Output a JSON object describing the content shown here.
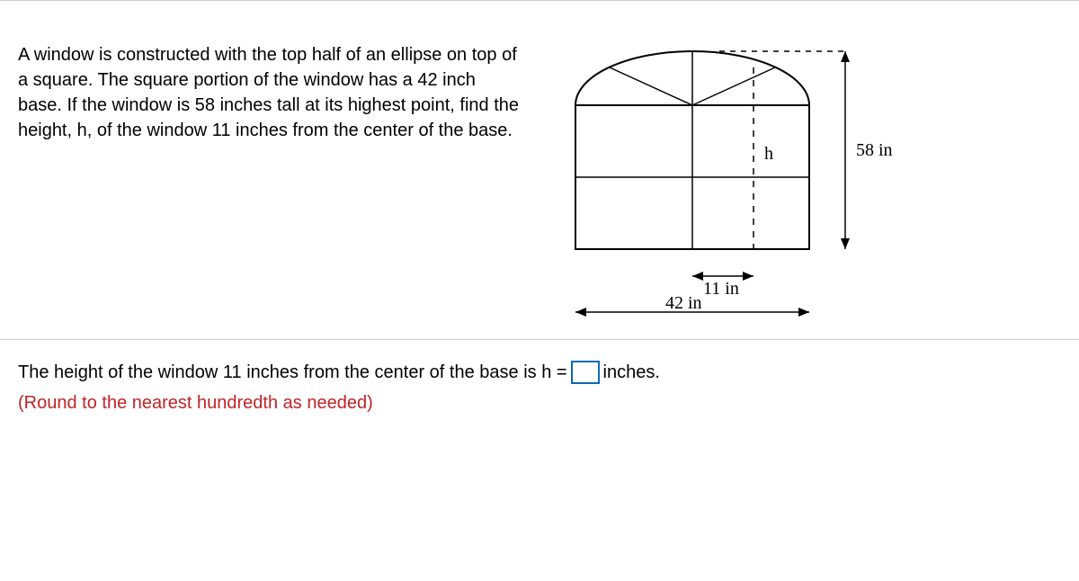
{
  "problem": {
    "text": "A window is constructed with the top half of an ellipse on top of a square. The square portion of the window has a 42 inch base. If the window is 58 inches tall at its highest point, find the height, h, of the window 11 inches from the center of the base."
  },
  "figure": {
    "inner_width_label": "11 in",
    "base_label": "42 in",
    "total_height_label": "58 in",
    "height_var_label": "h"
  },
  "answer": {
    "prefix": "The height of the window 11 inches from the center of the base is h =",
    "suffix": "inches.",
    "round_note": "(Round to the nearest hundredth as needed)",
    "input_value": ""
  }
}
